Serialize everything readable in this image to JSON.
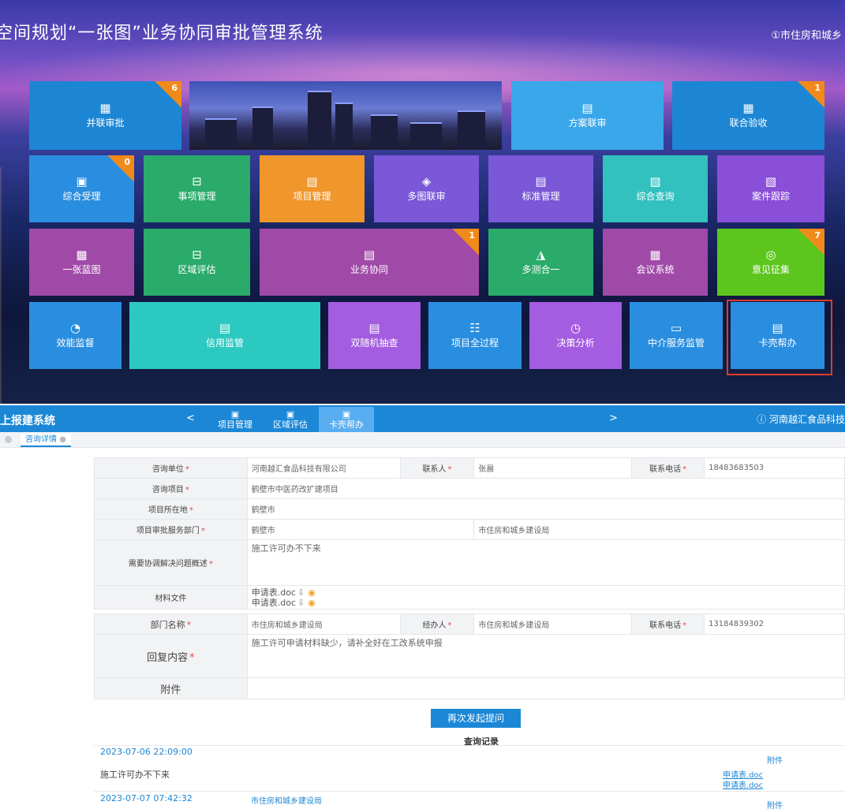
{
  "header": {
    "title": "空间规划“一张图”业务协同审批管理系统",
    "user": "①市住房和城乡"
  },
  "tiles": {
    "binglian": {
      "label": "并联审批",
      "badge": "6",
      "color": "#1d86d4"
    },
    "fangan": {
      "label": "方案联审",
      "color": "#3aa7ea"
    },
    "lianhe": {
      "label": "联合验收",
      "badge": "1",
      "color": "#1d86d4"
    },
    "zonghe_shouli": {
      "label": "综合受理",
      "badge": "0",
      "color": "#2a8ee0"
    },
    "shixiang": {
      "label": "事项管理",
      "color": "#2aab6a"
    },
    "xiangmu": {
      "label": "项目管理",
      "color": "#f0962b"
    },
    "duotu": {
      "label": "多图联审",
      "color": "#7a58d8"
    },
    "biaozhun": {
      "label": "标准管理",
      "color": "#7a58d8"
    },
    "zonghe_chaxun": {
      "label": "综合查询",
      "color": "#33c1c0"
    },
    "anjian": {
      "label": "案件跟踪",
      "color": "#8a4fd8"
    },
    "yizhang": {
      "label": "一张蓝图",
      "color": "#a04aa8"
    },
    "quyu": {
      "label": "区域评估",
      "color": "#2aab6a"
    },
    "yewu": {
      "label": "业务协同",
      "badge": "1",
      "color": "#a04aa8"
    },
    "duoce": {
      "label": "多测合一",
      "color": "#2aab6a"
    },
    "huiyi": {
      "label": "会议系统",
      "color": "#a04aa8"
    },
    "yijian": {
      "label": "意见征集",
      "badge": "7",
      "color": "#5cc61e"
    },
    "xiaoneng": {
      "label": "效能监督",
      "color": "#2a8ee0"
    },
    "xinyong": {
      "label": "信用监管",
      "color": "#2cc9c0"
    },
    "shuangsui": {
      "label": "双随机抽查",
      "color": "#a45ce0"
    },
    "quanguocheng": {
      "label": "项目全过程",
      "color": "#2a8ee0"
    },
    "juece": {
      "label": "决策分析",
      "color": "#a45ce0"
    },
    "zhongjie": {
      "label": "中介服务监管",
      "color": "#2a8ee0"
    },
    "kake": {
      "label": "卡壳帮办",
      "color": "#2a8ee0"
    }
  },
  "nav": {
    "brand": "上报建系统",
    "prev": "<",
    "next": ">",
    "items": [
      "项目管理",
      "区域评估",
      "卡壳帮办"
    ],
    "company": "河南越汇食品科技"
  },
  "tabs": {
    "active": "咨询详情"
  },
  "form": {
    "unit_label": "咨询单位",
    "unit_value": "河南越汇食品科技有限公司",
    "contact_label": "联系人",
    "contact_value": "张晨",
    "phone_label": "联系电话",
    "phone_value": "18483683503",
    "project_label": "咨询项目",
    "project_value": "鹤壁市中医药改扩建项目",
    "location_label": "项目所在地",
    "location_value": "鹤壁市",
    "dept_label": "项目审批服务部门",
    "dept_city": "鹤壁市",
    "dept_value": "市住房和城乡建设局",
    "issue_label": "需要协调解决问题概述",
    "issue_value": "施工许可办不下来",
    "files_label": "材料文件",
    "files": [
      "申请表.doc",
      "申请表.doc"
    ],
    "reply_dept_label": "部门名称",
    "reply_dept_value": "市住房和城乡建设局",
    "handler_label": "经办人",
    "handler_value": "市住房和城乡建设局",
    "reply_phone_label": "联系电话",
    "reply_phone_value": "13184839302",
    "reply_label": "回复内容",
    "reply_value": "施工许可申请材料缺少，请补全好在工改系统申报",
    "attach_label": "附件"
  },
  "actions": {
    "resend": "再次发起提问"
  },
  "records": {
    "title": "查询记录",
    "items": [
      {
        "time": "2023-07-06 22:09:00",
        "text": "施工许可办不下来",
        "attach_label": "附件",
        "files": [
          "申请表.doc",
          "申请表.doc"
        ]
      },
      {
        "time": "2023-07-07 07:42:32",
        "dept": "市住房和城乡建设局",
        "attach_label": "附件"
      }
    ]
  }
}
